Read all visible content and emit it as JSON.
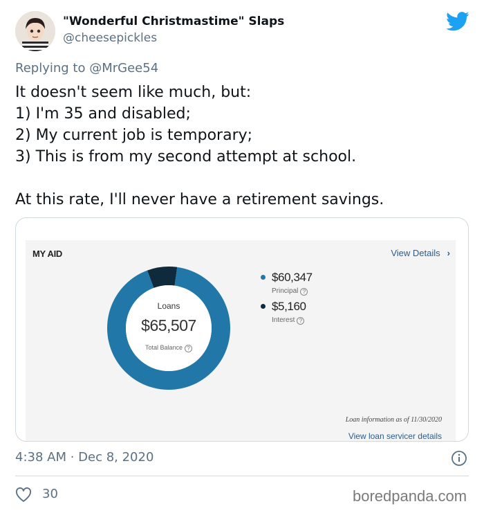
{
  "author": {
    "name": "\"Wonderful Christmastime\" Slaps",
    "handle": "@cheesepickles"
  },
  "icons": {
    "brand": "twitter-bird-icon",
    "info": "info-icon",
    "like": "heart-icon",
    "chevron": "chevron-right-icon"
  },
  "colors": {
    "twitter_blue": "#1da1f2",
    "principal": "#2178a8",
    "interest": "#0f2a3a",
    "link": "#2b5c8c"
  },
  "tweet": {
    "replying_prefix": "Replying to",
    "replying_to": "@MrGee54",
    "lines": [
      "It doesn't seem like much, but:",
      "1) I'm 35 and disabled;",
      "2) My current job is temporary;",
      "3) This is from my second attempt at school.",
      "",
      "At this rate, I'll never have a retirement savings."
    ],
    "timestamp": "4:38 AM · Dec 8, 2020",
    "likes": "30"
  },
  "card": {
    "title": "MY AID",
    "view_details": "View Details",
    "donut_title": "Loans",
    "total_amount": "$65,507",
    "total_label": "Total Balance",
    "legend": [
      {
        "value": "$60,347",
        "label": "Principal"
      },
      {
        "value": "$5,160",
        "label": "Interest"
      }
    ],
    "loan_info": "Loan information as of 11/30/2020",
    "servicer_link": "View loan servicer details"
  },
  "chart_data": {
    "type": "pie",
    "categories": [
      "Principal",
      "Interest"
    ],
    "values": [
      60347,
      5160
    ],
    "title": "Loans"
  },
  "watermark": "boredpanda.com"
}
